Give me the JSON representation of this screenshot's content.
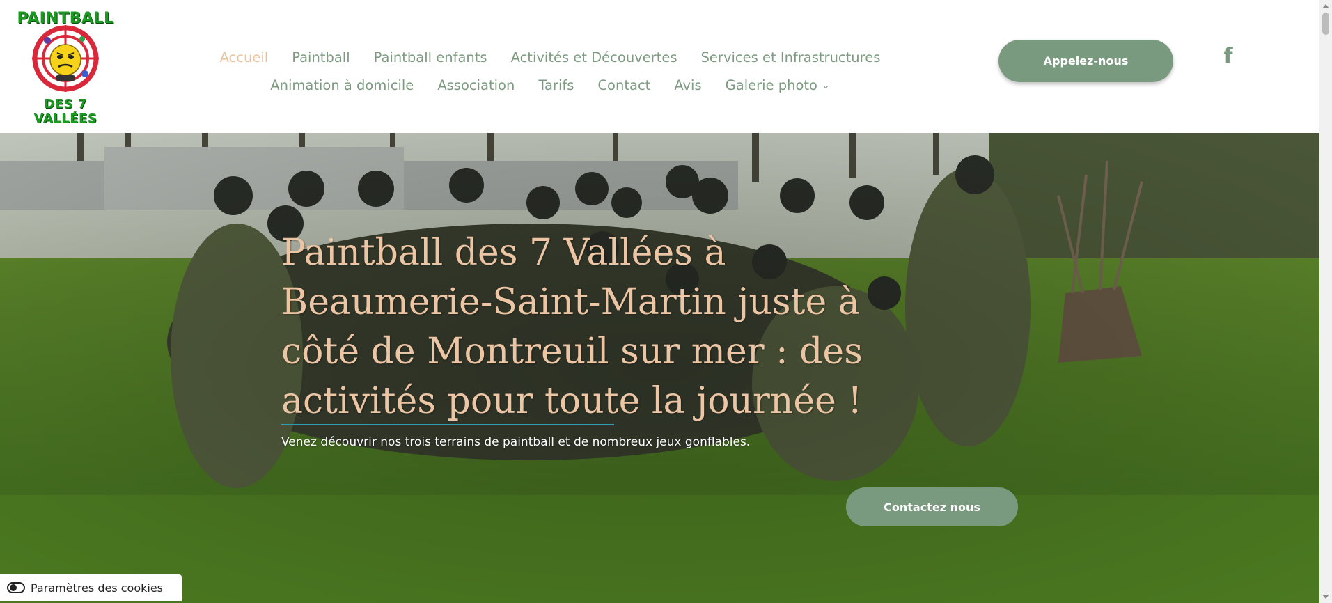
{
  "logo": {
    "top_text": "PAINTBALL",
    "bottom_text": "DES 7 VALLÉES"
  },
  "nav": {
    "row1": [
      {
        "label": "Accueil",
        "active": true
      },
      {
        "label": "Paintball"
      },
      {
        "label": "Paintball enfants"
      },
      {
        "label": "Activités et Découvertes"
      },
      {
        "label": "Services et Infrastructures"
      }
    ],
    "row2": [
      {
        "label": "Animation à domicile"
      },
      {
        "label": "Association"
      },
      {
        "label": "Tarifs"
      },
      {
        "label": "Contact"
      },
      {
        "label": "Avis"
      },
      {
        "label": "Galerie photo",
        "dropdown": true
      }
    ]
  },
  "header": {
    "call_button": "Appelez-nous",
    "social_icon": "facebook-icon",
    "social_glyph": "f"
  },
  "hero": {
    "title": "Paintball des 7 Vallées à Beaumerie-Saint-Martin juste à côté de Montreuil sur mer : des activités pour toute la journée !",
    "subtitle": "Venez découvrir nos trois terrains de paintball et de nombreux jeux gonflables.",
    "cta": "Contactez nous"
  },
  "cookie": {
    "label": "Paramètres des cookies",
    "icon": "cookie-toggle-icon"
  },
  "colors": {
    "accent": "#7a9a80",
    "active_nav": "#e8c4a2",
    "hero_title": "#ecc5a4",
    "underline": "#2b9fb1"
  }
}
